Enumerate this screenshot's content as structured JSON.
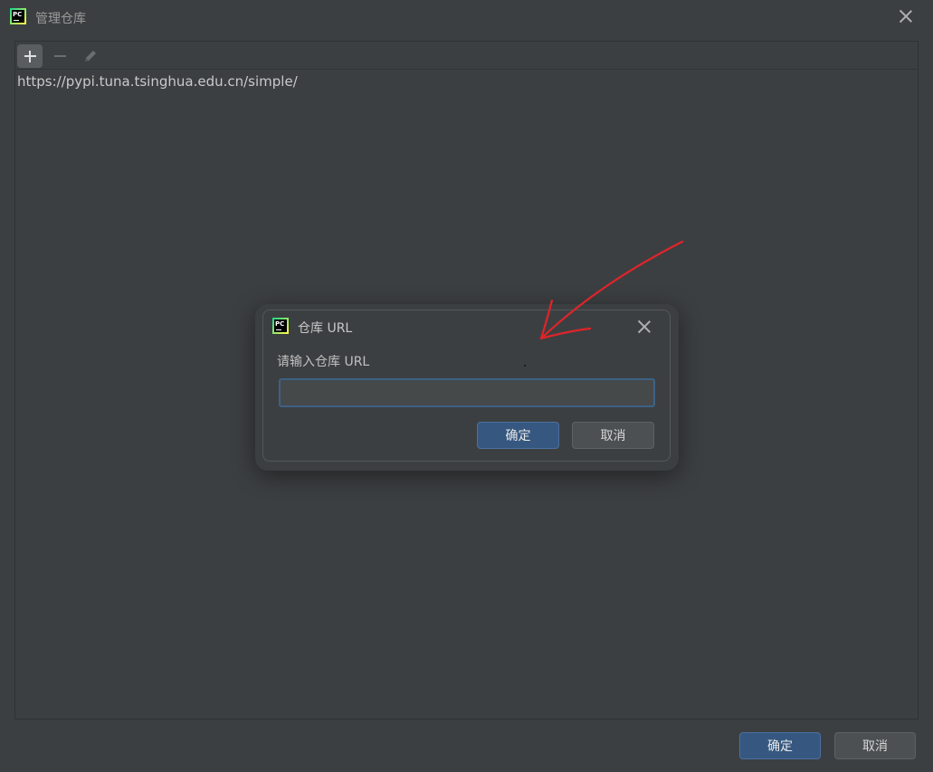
{
  "window": {
    "title": "管理仓库",
    "icon_text": "PC"
  },
  "toolbar": {
    "add_icon": "plus-icon",
    "remove_icon": "minus-icon",
    "edit_icon": "pencil-icon"
  },
  "repositories": [
    "https://pypi.tuna.tsinghua.edu.cn/simple/"
  ],
  "footer": {
    "ok_label": "确定",
    "cancel_label": "取消"
  },
  "dialog": {
    "title": "仓库 URL",
    "icon_text": "PC",
    "prompt": "请输入仓库 URL",
    "input_value": "",
    "ok_label": "确定",
    "cancel_label": "取消"
  },
  "colors": {
    "background": "#3c3f41",
    "primary_button": "#365880",
    "secondary_button": "#4c5052",
    "input_focus_border": "#3d6185",
    "annotation_arrow": "#e0242a"
  }
}
